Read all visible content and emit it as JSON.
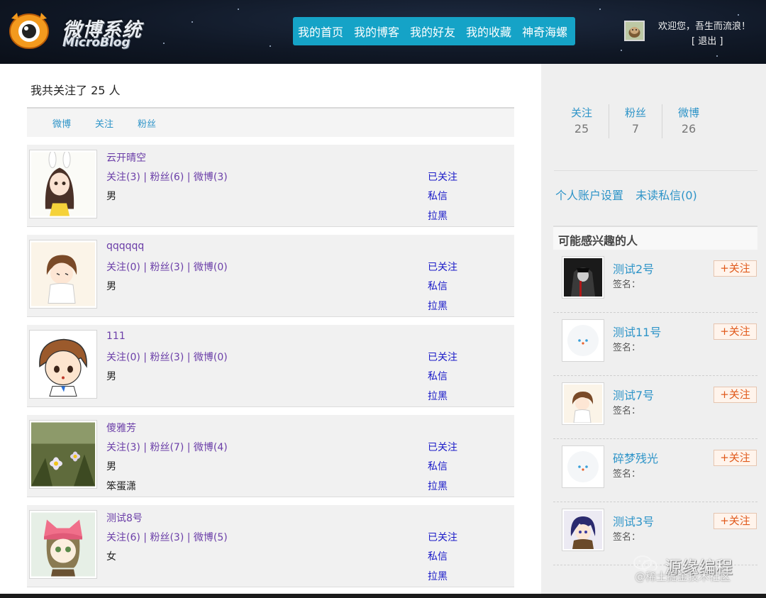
{
  "header": {
    "logo_title": "微博系统",
    "logo_subtitle": "MicroBlog",
    "nav": [
      "我的首页",
      "我的博客",
      "我的好友",
      "我的收藏",
      "神奇海螺"
    ],
    "welcome_text": "欢迎您，吾生而流浪！",
    "logout_text": "[ 退出 ]"
  },
  "main": {
    "follow_count_text": "我共关注了 25 人",
    "tabs": [
      "微博",
      "关注",
      "粉丝"
    ],
    "users": [
      {
        "name": "云开晴空",
        "stats": "关注(3) | 粉丝(6) | 微博(3)",
        "gender": "男",
        "signature": "",
        "actions": [
          "已关注",
          "私信",
          "拉黑"
        ]
      },
      {
        "name": "qqqqqq",
        "stats": "关注(0) | 粉丝(3) | 微博(0)",
        "gender": "男",
        "signature": "",
        "actions": [
          "已关注",
          "私信",
          "拉黑"
        ]
      },
      {
        "name": "111",
        "stats": "关注(0) | 粉丝(3) | 微博(0)",
        "gender": "男",
        "signature": "",
        "actions": [
          "已关注",
          "私信",
          "拉黑"
        ]
      },
      {
        "name": "傻雅芳",
        "stats": "关注(3) | 粉丝(7) | 微博(4)",
        "gender": "男",
        "signature": "笨蛋潇",
        "actions": [
          "已关注",
          "私信",
          "拉黑"
        ]
      },
      {
        "name": "测试8号",
        "stats": "关注(6) | 粉丝(3) | 微博(5)",
        "gender": "女",
        "signature": "",
        "actions": [
          "已关注",
          "私信",
          "拉黑"
        ]
      }
    ]
  },
  "sidebar": {
    "stats": [
      {
        "label": "关注",
        "value": "25"
      },
      {
        "label": "粉丝",
        "value": "7"
      },
      {
        "label": "微博",
        "value": "26"
      }
    ],
    "links": [
      "个人账户设置",
      "未读私信(0)"
    ],
    "maybe_title": "可能感兴趣的人",
    "suggestions": [
      {
        "name": "测试2号",
        "signature": "签名：",
        "button": "+关注"
      },
      {
        "name": "测试11号",
        "signature": "签名：",
        "button": "+关注"
      },
      {
        "name": "测试7号",
        "signature": "签名：",
        "button": "+关注"
      },
      {
        "name": "碎梦残光",
        "signature": "签名：",
        "button": "+关注"
      },
      {
        "name": "测试3号",
        "signature": "签名：",
        "button": "+关注"
      }
    ]
  },
  "watermark": {
    "title": "源缘编程",
    "subtitle": "@稀土掘金技术社区"
  },
  "colors": {
    "nav_bg": "#15a3c7",
    "link": "#2e94c8",
    "purple_text": "#6b3ea8",
    "action_blue": "#1a1ac8",
    "follow_btn": "#e05a1c"
  }
}
